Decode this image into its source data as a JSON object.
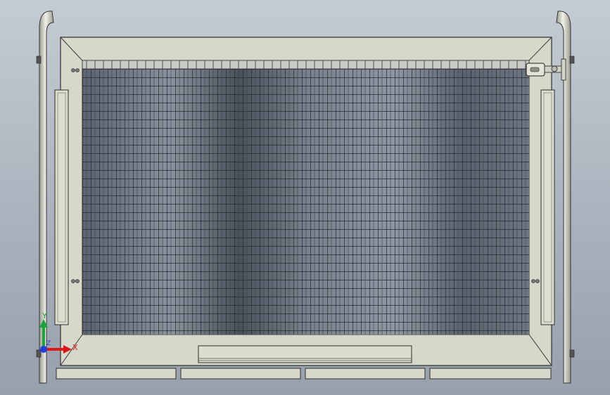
{
  "viewport": {
    "background_top": "#c4cbd3",
    "background_bottom": "#97a0ab"
  },
  "model": {
    "metal_color": "#d7d7c9",
    "edge_color": "#3a3a3a",
    "mesh_color": "#2f343b"
  },
  "triad": {
    "x_label": "X",
    "y_label": "Y",
    "z_label": "Z",
    "x_color": "#e0141b",
    "y_color": "#19a43a",
    "z_color": "#1f3fe0"
  }
}
